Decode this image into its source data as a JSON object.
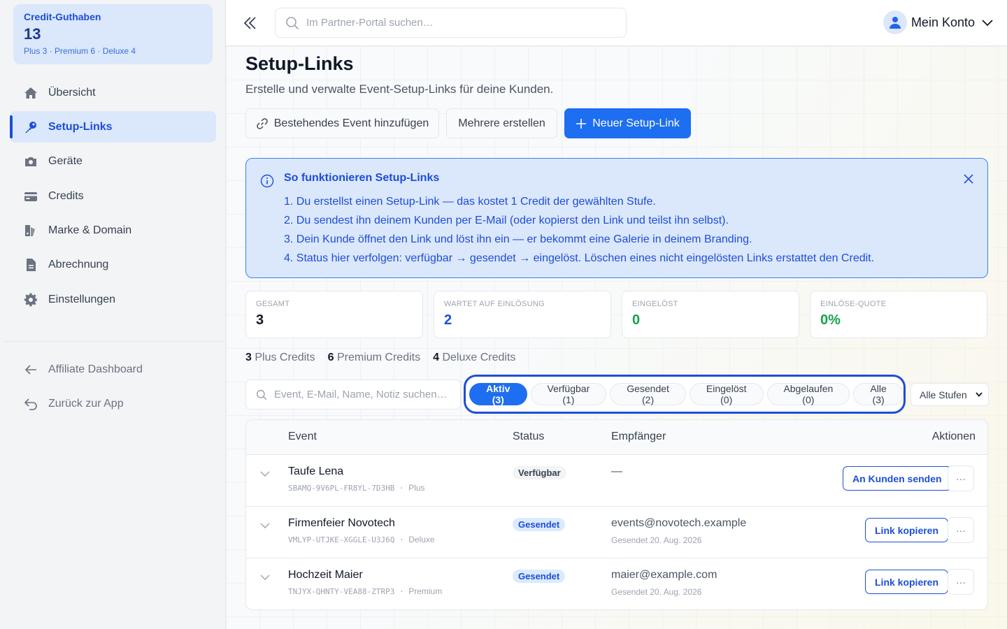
{
  "sidebar": {
    "credit": {
      "title": "Credit-Guthaben",
      "total": "13",
      "breakdown": "Plus 3 · Premium 6 · Deluxe 4"
    },
    "items": [
      {
        "label": "Übersicht",
        "icon": "home-icon"
      },
      {
        "label": "Setup-Links",
        "icon": "key-icon",
        "active": true
      },
      {
        "label": "Geräte",
        "icon": "camera-icon"
      },
      {
        "label": "Credits",
        "icon": "card-icon"
      },
      {
        "label": "Marke & Domain",
        "icon": "brand-icon"
      },
      {
        "label": "Abrechnung",
        "icon": "document-icon"
      },
      {
        "label": "Einstellungen",
        "icon": "gear-icon"
      }
    ],
    "footer_items": [
      {
        "label": "Affiliate Dashboard",
        "icon": "arrow-left-icon"
      },
      {
        "label": "Zurück zur App",
        "icon": "undo-icon"
      }
    ]
  },
  "topbar": {
    "search_placeholder": "Im Partner-Portal suchen…",
    "account_label": "Mein Konto"
  },
  "page": {
    "title": "Setup-Links",
    "subtitle": "Erstelle und verwalte Event-Setup-Links für deine Kunden.",
    "buttons": {
      "add_existing": "Bestehendes Event hinzufügen",
      "bulk_create": "Mehrere erstellen",
      "new_link": "Neuer Setup-Link"
    }
  },
  "info": {
    "title": "So funktionieren Setup-Links",
    "steps": [
      "1. Du erstellst einen Setup-Link — das kostet 1 Credit der gewählten Stufe.",
      "2. Du sendest ihn deinem Kunden per E-Mail (oder kopierst den Link und teilst ihn selbst).",
      "3. Dein Kunde öffnet den Link und löst ihn ein — er bekommt eine Galerie in deinem Branding.",
      "4. Status hier verfolgen: verfügbar → gesendet → eingelöst. Löschen eines nicht eingelösten Links erstattet den Credit."
    ]
  },
  "stats": [
    {
      "label": "GESAMT",
      "value": "3",
      "color": "#111827"
    },
    {
      "label": "WARTET AUF EINLÖSUNG",
      "value": "2",
      "color": "#1d4ed8"
    },
    {
      "label": "EINGELÖST",
      "value": "0",
      "color": "#16a34a"
    },
    {
      "label": "EINLÖSE-QUOTE",
      "value": "0%",
      "color": "#16a34a"
    }
  ],
  "credits_summary": [
    {
      "count": "3",
      "label": "Plus Credits"
    },
    {
      "count": "6",
      "label": "Premium Credits"
    },
    {
      "count": "4",
      "label": "Deluxe Credits"
    }
  ],
  "filters": {
    "search_placeholder": "Event, E-Mail, Name, Notiz suchen…",
    "tabs": [
      "Aktiv (3)",
      "Verfügbar (1)",
      "Gesendet (2)",
      "Eingelöst (0)",
      "Abgelaufen (0)",
      "Alle (3)"
    ],
    "active_tab": 0,
    "tier_select": "Alle Stufen"
  },
  "table": {
    "headers": {
      "event": "Event",
      "status": "Status",
      "recipient": "Empfänger",
      "actions": "Aktionen"
    },
    "rows": [
      {
        "name": "Taufe Lena",
        "code": "SBAMQ-9V6PL-FR8YL-7D3HB",
        "tier": "Plus",
        "status": "Verfügbar",
        "status_style": "grey",
        "recipient": "—",
        "recipient_sub": "",
        "action": "An Kunden senden",
        "more": "···"
      },
      {
        "name": "Firmenfeier Novotech",
        "code": "VMLYP-UTJKE-XGGLE-U3J6Q",
        "tier": "Deluxe",
        "status": "Gesendet",
        "status_style": "blue",
        "recipient": "events@novotech.example",
        "recipient_sub": "Gesendet 20. Aug. 2026",
        "action": "Link kopieren",
        "more": "···"
      },
      {
        "name": "Hochzeit Maier",
        "code": "TNJYX-QHNTY-VEA88-ZTRP3",
        "tier": "Premium",
        "status": "Gesendet",
        "status_style": "blue",
        "recipient": "maier@example.com",
        "recipient_sub": "Gesendet 20. Aug. 2026",
        "action": "Link kopieren",
        "more": "···"
      }
    ]
  },
  "colors": {
    "accent": "#1d6ef0",
    "accent_dark": "#1d4ed8",
    "info_bg": "#dbe7fb",
    "success": "#16a34a"
  }
}
